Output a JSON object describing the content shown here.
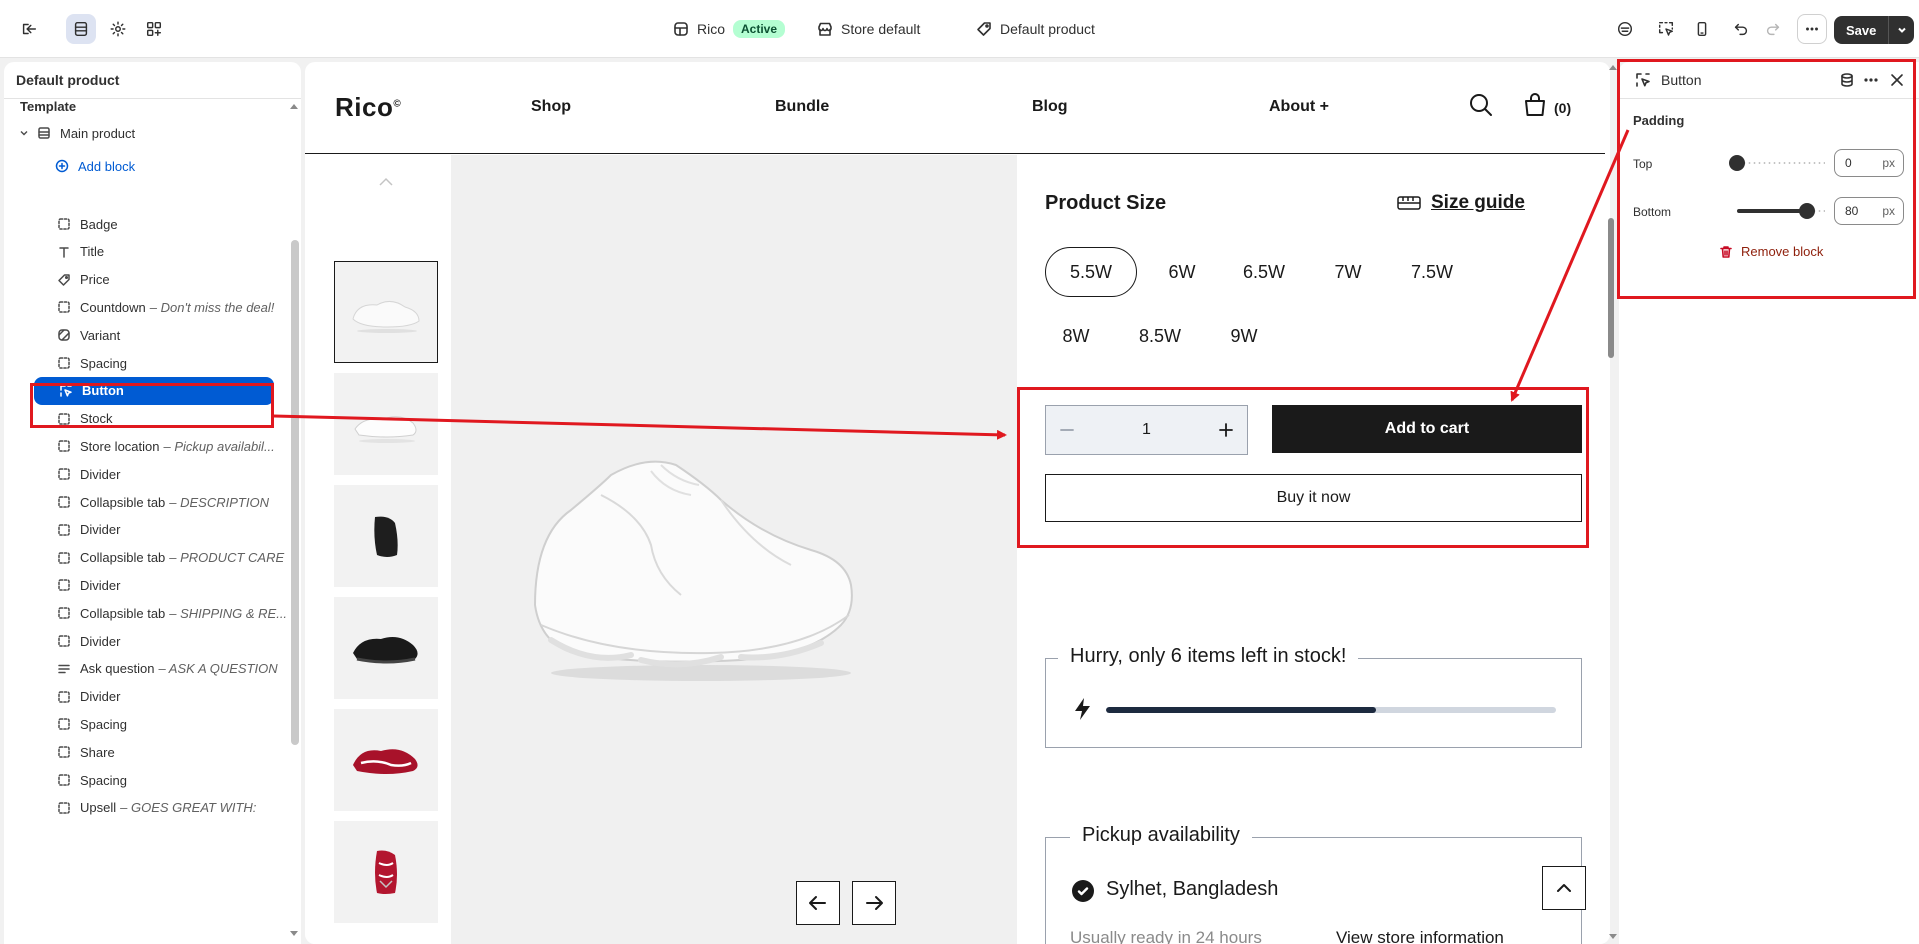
{
  "topbar": {
    "theme_name": "Rico",
    "theme_status": "Active",
    "store": "Store default",
    "template": "Default product",
    "save_label": "Save"
  },
  "sidebar": {
    "title": "Default product",
    "section": "Template",
    "group": "Main product",
    "add_block": "Add block",
    "items": [
      {
        "label": "Badge",
        "sub": "",
        "icon": "dashed-square-icon"
      },
      {
        "label": "Title",
        "sub": "",
        "icon": "text-icon"
      },
      {
        "label": "Price",
        "sub": "",
        "icon": "tag-icon"
      },
      {
        "label": "Countdown",
        "sub": "– Don't miss the deal!",
        "icon": "dashed-square-icon"
      },
      {
        "label": "Variant",
        "sub": "",
        "icon": "variant-icon"
      },
      {
        "label": "Spacing",
        "sub": "",
        "icon": "dashed-square-icon"
      },
      {
        "label": "Button",
        "sub": "",
        "icon": "cursor-click-icon"
      },
      {
        "label": "Stock",
        "sub": "",
        "icon": "dashed-square-icon"
      },
      {
        "label": "Store location",
        "sub": "– Pickup availabil...",
        "icon": "dashed-square-icon"
      },
      {
        "label": "Divider",
        "sub": "",
        "icon": "dashed-square-icon"
      },
      {
        "label": "Collapsible tab",
        "sub": "– DESCRIPTION",
        "icon": "dashed-square-icon"
      },
      {
        "label": "Divider",
        "sub": "",
        "icon": "dashed-square-icon"
      },
      {
        "label": "Collapsible tab",
        "sub": "– PRODUCT CARE",
        "icon": "dashed-square-icon"
      },
      {
        "label": "Divider",
        "sub": "",
        "icon": "dashed-square-icon"
      },
      {
        "label": "Collapsible tab",
        "sub": "– SHIPPING & RE...",
        "icon": "dashed-square-icon"
      },
      {
        "label": "Divider",
        "sub": "",
        "icon": "dashed-square-icon"
      },
      {
        "label": "Ask question",
        "sub": "– ASK A QUESTION",
        "icon": "text-lines-icon"
      },
      {
        "label": "Divider",
        "sub": "",
        "icon": "dashed-square-icon"
      },
      {
        "label": "Spacing",
        "sub": "",
        "icon": "dashed-square-icon"
      },
      {
        "label": "Share",
        "sub": "",
        "icon": "dashed-square-icon"
      },
      {
        "label": "Spacing",
        "sub": "",
        "icon": "dashed-square-icon"
      },
      {
        "label": "Upsell",
        "sub": "– GOES GREAT WITH:",
        "icon": "dashed-square-icon"
      }
    ],
    "selected_label": "Button"
  },
  "store": {
    "logo": "Rico",
    "logo_mark": "©",
    "nav": [
      "Shop",
      "Bundle",
      "Blog",
      "About +"
    ],
    "cart_count": "(0)",
    "size_title": "Product Size",
    "size_guide": "Size guide",
    "sizes": [
      "5.5W",
      "6W",
      "6.5W",
      "7W",
      "7.5W",
      "8W",
      "8.5W",
      "9W"
    ],
    "selected_size": "5.5W",
    "quantity": "1",
    "add_to_cart": "Add to cart",
    "buy_now": "Buy it now",
    "stock_title": "Hurry, only 6 items left in stock!",
    "stock_fraction": 0.6,
    "pickup_title": "Pickup availability",
    "pickup_location": "Sylhet, Bangladesh",
    "pickup_ready": "Usually ready in 24 hours",
    "view_store": "View store information"
  },
  "panel": {
    "title": "Button",
    "section": "Padding",
    "top_label": "Top",
    "top_value": "0",
    "top_fraction": 0,
    "bottom_label": "Bottom",
    "bottom_value": "80",
    "bottom_fraction": 0.8,
    "unit": "px",
    "remove_label": "Remove block"
  },
  "colors": {
    "selected_blue": "#005bd3",
    "annotation_red": "#e0181f",
    "active_badge": "#b4fed2"
  }
}
